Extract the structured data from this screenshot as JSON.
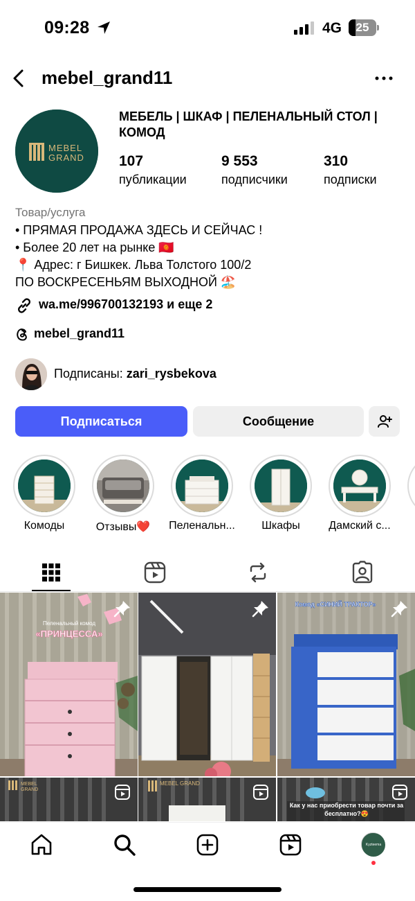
{
  "status_bar": {
    "time": "09:28",
    "network": "4G",
    "battery": "25"
  },
  "header": {
    "username": "mebel_grand11"
  },
  "profile": {
    "avatar_logo": {
      "line1": "MEBEL",
      "line2": "GRAND"
    },
    "name": "МЕБЕЛЬ | ШКАФ | ПЕЛЕНАЛЬНЫЙ СТОЛ | КОМОД",
    "stats": [
      {
        "value": "107",
        "label": "публикации"
      },
      {
        "value": "9 553",
        "label": "подписчики"
      },
      {
        "value": "310",
        "label": "подписки"
      }
    ],
    "category": "Товар/услуга",
    "bio": [
      "• ПРЯМАЯ ПРОДАЖА ЗДЕСЬ И СЕЙЧАС !",
      "• Более 20 лет на рынке 🇰🇬",
      "📍 Адрес: г Бишкек. Льва Толстого 100/2",
      "ПО ВОСКРЕСЕНЬЯМ ВЫХОДНОЙ 🏖️"
    ],
    "link": "wa.me/996700132193 и еще 2",
    "threads": "mebel_grand11",
    "followed_by_prefix": "Подписаны: ",
    "followed_by_user": "zari_rysbekova"
  },
  "actions": {
    "follow": "Подписаться",
    "message": "Сообщение"
  },
  "highlights": [
    {
      "label": "Комоды"
    },
    {
      "label": "Отзывы❤️"
    },
    {
      "label": "Пеленальн..."
    },
    {
      "label": "Шкафы"
    },
    {
      "label": "Дамский с..."
    }
  ],
  "posts": {
    "p1_caption_small": "Пеленальный комод",
    "p1_caption_big": "«ПРИНЦЕССА»",
    "p3_caption": "Комод «СИНИЙ ТРАКТОР»",
    "r2_logo": "MEBEL GRAND",
    "r3_text": "Как у нас приобрести товар почти за бесплатно?😍"
  },
  "bottom_nav": {
    "profile_avatar_text": "Kyzteema"
  },
  "colors": {
    "follow_button": "#4a5df9",
    "logo_green": "#0f4a43",
    "logo_gold": "#d9b87a"
  }
}
